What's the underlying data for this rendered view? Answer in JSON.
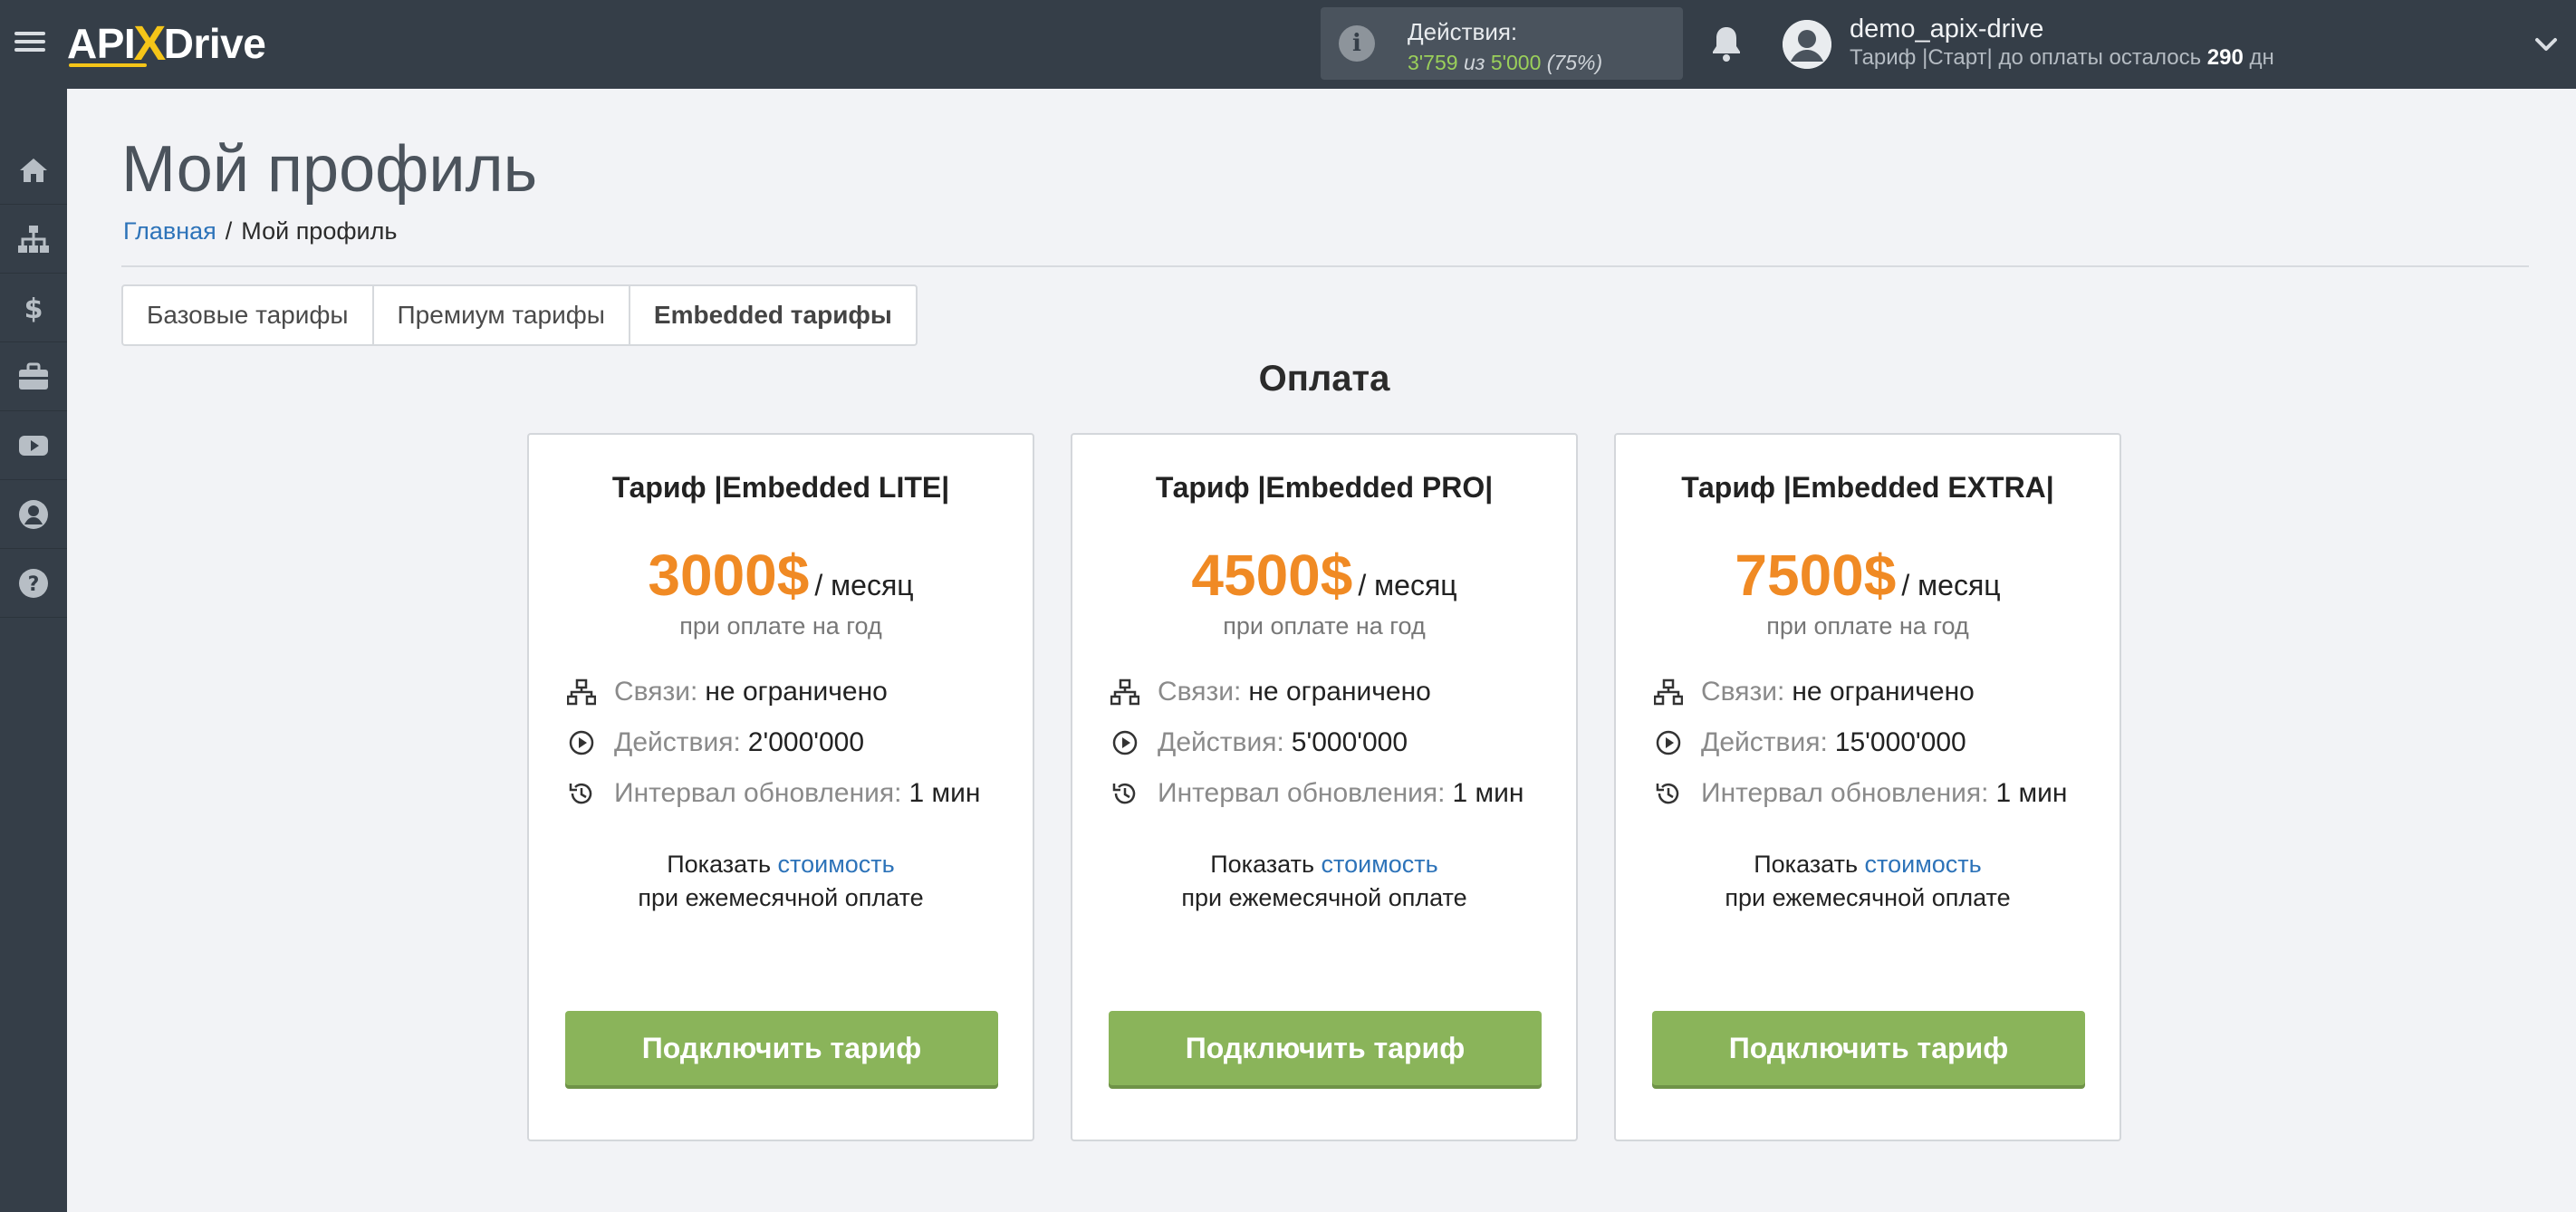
{
  "header": {
    "logo": {
      "left": "API",
      "x": "X",
      "right": "Drive"
    },
    "actions": {
      "label": "Действия:",
      "used": "3'759",
      "of": "из",
      "total": "5'000",
      "percent": "(75%)"
    },
    "user": {
      "name": "demo_apix-drive",
      "plan_prefix": "Тариф |Старт| до оплаты осталось",
      "days": "290",
      "days_suffix": "дн"
    }
  },
  "sidebar": {
    "items": [
      {
        "icon": "home-icon"
      },
      {
        "icon": "sitemap-icon"
      },
      {
        "icon": "dollar-icon"
      },
      {
        "icon": "briefcase-icon"
      },
      {
        "icon": "youtube-icon"
      },
      {
        "icon": "user-icon"
      },
      {
        "icon": "help-icon"
      }
    ]
  },
  "page": {
    "title": "Мой профиль",
    "breadcrumb": {
      "home": "Главная",
      "sep": "/",
      "current": "Мой профиль"
    }
  },
  "tabs": [
    {
      "label": "Базовые тарифы",
      "active": false
    },
    {
      "label": "Премиум тарифы",
      "active": false
    },
    {
      "label": "Embedded тарифы",
      "active": true
    }
  ],
  "section_title": "Оплата",
  "plans": [
    {
      "title": "Тариф |Embedded LITE|",
      "price": "3000$",
      "per": "/ месяц",
      "yearly": "при оплате на год",
      "links_label": "Связи:",
      "links_value": "не ограничено",
      "actions_label": "Действия:",
      "actions_value": "2'000'000",
      "interval_label": "Интервал обновления:",
      "interval_value": "1 мин",
      "monthly_prefix": "Показать",
      "monthly_link": "стоимость",
      "monthly_suffix": "при ежемесячной оплате",
      "button": "Подключить тариф"
    },
    {
      "title": "Тариф |Embedded PRO|",
      "price": "4500$",
      "per": "/ месяц",
      "yearly": "при оплате на год",
      "links_label": "Связи:",
      "links_value": "не ограничено",
      "actions_label": "Действия:",
      "actions_value": "5'000'000",
      "interval_label": "Интервал обновления:",
      "interval_value": "1 мин",
      "monthly_prefix": "Показать",
      "monthly_link": "стоимость",
      "monthly_suffix": "при ежемесячной оплате",
      "button": "Подключить тариф"
    },
    {
      "title": "Тариф |Embedded EXTRA|",
      "price": "7500$",
      "per": "/ месяц",
      "yearly": "при оплате на год",
      "links_label": "Связи:",
      "links_value": "не ограничено",
      "actions_label": "Действия:",
      "actions_value": "15'000'000",
      "interval_label": "Интервал обновления:",
      "interval_value": "1 мин",
      "monthly_prefix": "Показать",
      "monthly_link": "стоимость",
      "monthly_suffix": "при ежемесячной оплате",
      "button": "Подключить тариф"
    }
  ],
  "colors": {
    "topbar": "#353e48",
    "accent_price": "#f08a24",
    "button": "#8ab45a",
    "link": "#2d73b9",
    "actions_green": "#9bd05a"
  }
}
